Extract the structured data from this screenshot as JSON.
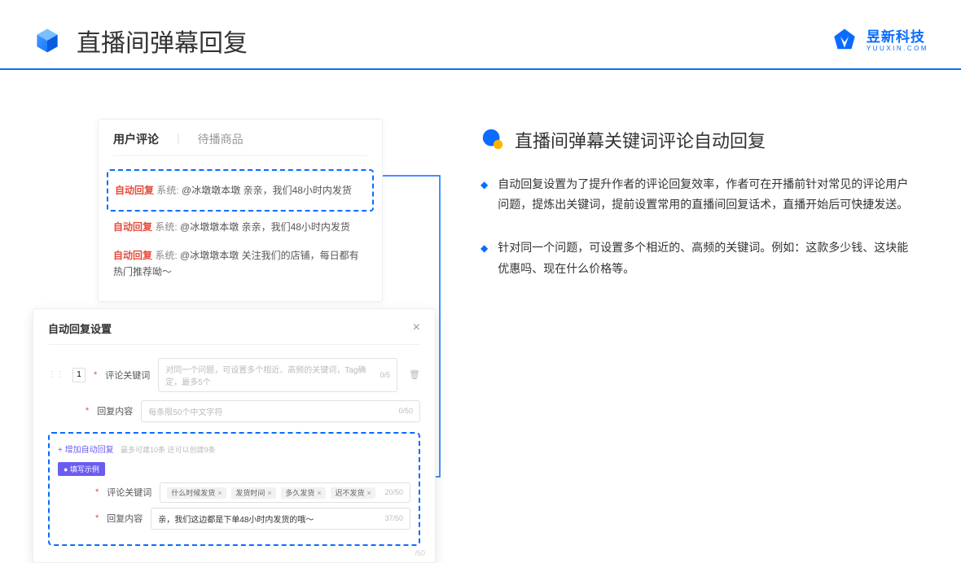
{
  "header": {
    "title": "直播间弹幕回复",
    "brand_cn": "昱新科技",
    "brand_en": "YUUXIN.COM"
  },
  "comments": {
    "tab_active": "用户评论",
    "tab_inactive": "待播商品",
    "items": [
      {
        "tag": "自动回复",
        "sys": "系统:",
        "body": "@冰墩墩本墩 亲亲，我们48小时内发货"
      },
      {
        "tag": "自动回复",
        "sys": "系统:",
        "body": "@冰墩墩本墩 亲亲，我们48小时内发货"
      },
      {
        "tag": "自动回复",
        "sys": "系统:",
        "body": "@冰墩墩本墩 关注我们的店铺，每日都有热门推荐呦～"
      }
    ]
  },
  "settings": {
    "title": "自动回复设置",
    "seq": "1",
    "row1": {
      "label": "评论关键词",
      "placeholder": "对同一个问题，可设置多个相近、高频的关键词，Tag确定，最多5个",
      "count": "0/5"
    },
    "row2": {
      "label": "回复内容",
      "placeholder": "每条限50个中文字符",
      "count": "0/50"
    },
    "add_link": "+ 增加自动回复",
    "add_hint": "最多可建10条 还可以创建9条",
    "badge": "● 填写示例",
    "ex1": {
      "label": "评论关键词",
      "tags": [
        "什么时候发货",
        "发货时间",
        "多久发货",
        "迟不发货"
      ],
      "count": "20/50"
    },
    "ex2": {
      "label": "回复内容",
      "value": "亲，我们这边都是下单48小时内发货的哦～",
      "count": "37/50"
    },
    "extra_count": "/50"
  },
  "right": {
    "section_title": "直播间弹幕关键词评论自动回复",
    "bullet1": "自动回复设置为了提升作者的评论回复效率，作者可在开播前针对常见的评论用户问题，提炼出关键词，提前设置常用的直播间回复话术，直播开始后可快捷发送。",
    "bullet2": "针对同一个问题，可设置多个相近的、高频的关键词。例如：这款多少钱、这块能优惠吗、现在什么价格等。"
  }
}
